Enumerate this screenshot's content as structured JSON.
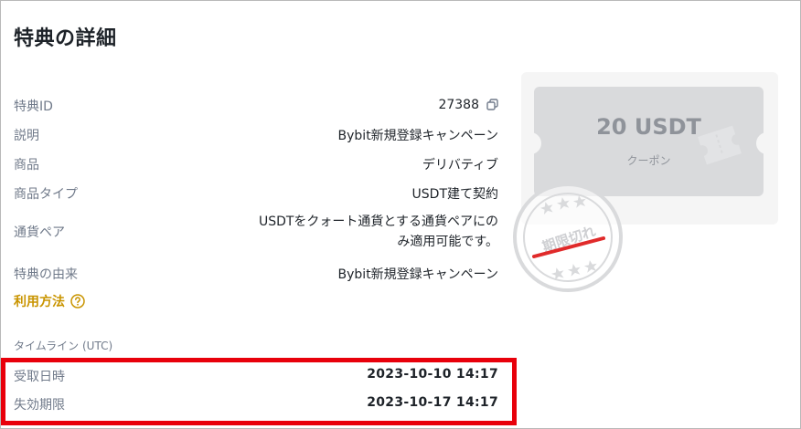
{
  "title": "特典の詳細",
  "details": [
    {
      "label": "特典ID",
      "value": "27388"
    },
    {
      "label": "説明",
      "value": "Bybit新規登録キャンペーン"
    },
    {
      "label": "商品",
      "value": "デリバティブ"
    },
    {
      "label": "商品タイプ",
      "value": "USDT建て契約"
    },
    {
      "label": "通貨ペア",
      "value_line1": "USDTをクォート通貨とする通貨ペアにの",
      "value_line2": "み適用可能です。"
    },
    {
      "label": "特典の由来",
      "value": "Bybit新規登録キャンペーン"
    }
  ],
  "howto_label": "利用方法",
  "timeline": {
    "label": "タイムライン (UTC)",
    "received_label": "受取日時",
    "received_value": "2023-10-10 14:17",
    "expiry_label": "失効期限",
    "expiry_value": "2023-10-17 14:17"
  },
  "coupon": {
    "amount": "20 USDT",
    "type": "クーポン",
    "stamp_text": "期限切れ"
  },
  "colors": {
    "accent": "#c99400",
    "highlight": "#e8000b",
    "label": "#707a8a",
    "stamp": "#d9dadc",
    "stamp_line": "#e02a2a"
  },
  "icons": {
    "copy": "copy-icon",
    "help": "question-circle-icon",
    "ticket": "ticket-icon"
  }
}
